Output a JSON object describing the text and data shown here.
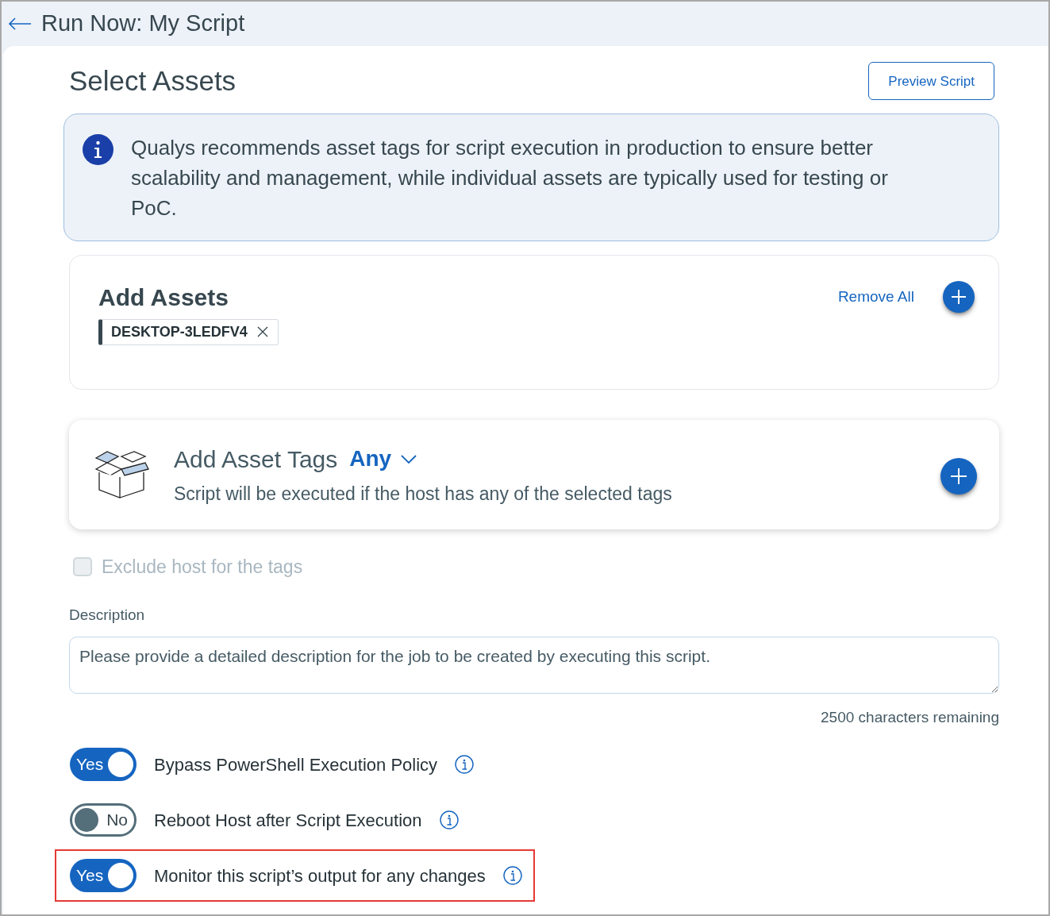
{
  "header": {
    "title": "Run Now: My Script"
  },
  "section": {
    "title": "Select Assets",
    "preview_button": "Preview Script"
  },
  "info_banner": {
    "text": "Qualys recommends asset tags for script execution in production to ensure better scalability and management, while individual assets are typically used for testing or PoC."
  },
  "add_assets": {
    "title": "Add Assets",
    "remove_all": "Remove All",
    "assets": [
      {
        "label": "DESKTOP-3LEDFV4"
      }
    ]
  },
  "asset_tags": {
    "title": "Add Asset Tags",
    "match": "Any",
    "subtitle": "Script will be executed if the host has any of the selected tags"
  },
  "exclude": {
    "label": "Exclude host for the tags",
    "checked": false,
    "disabled": true
  },
  "description": {
    "label": "Description",
    "placeholder": "Please provide a detailed description for the job to be created by executing this script.",
    "counter": "2500 characters remaining"
  },
  "options": [
    {
      "label": "Bypass PowerShell Execution Policy",
      "on": true,
      "toggle_text": "Yes",
      "highlighted": false
    },
    {
      "label": "Reboot Host after Script Execution",
      "on": false,
      "toggle_text": "No",
      "highlighted": false
    },
    {
      "label": "Monitor this script’s output for any changes",
      "on": true,
      "toggle_text": "Yes",
      "highlighted": true
    }
  ]
}
